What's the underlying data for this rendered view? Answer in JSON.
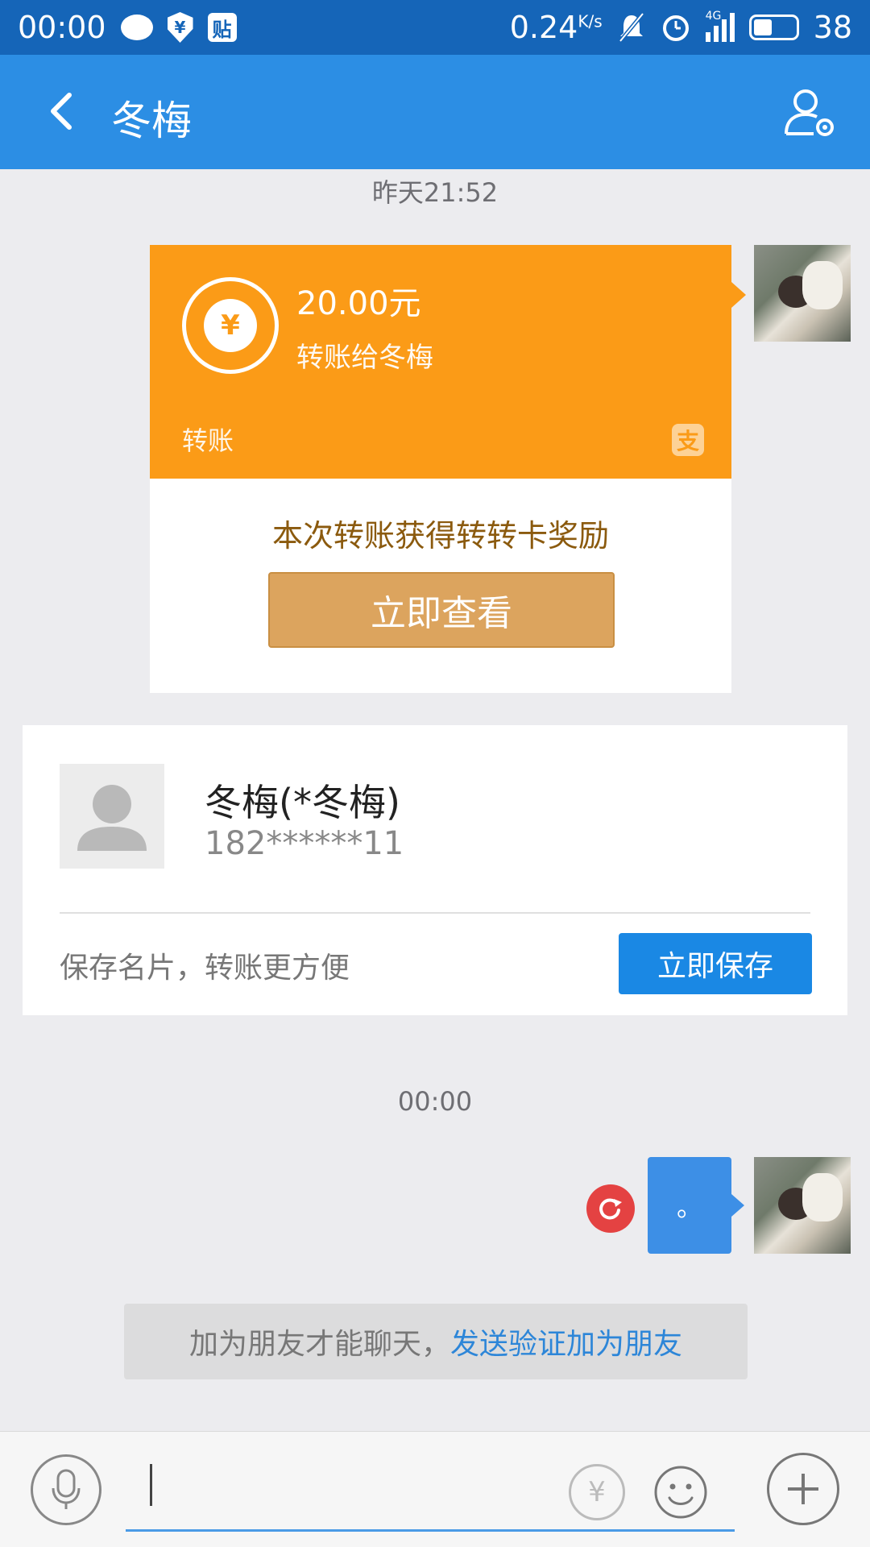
{
  "status_bar": {
    "time": "00:00",
    "badge_text": "贴",
    "shield_text": "¥",
    "speed_value": "0.24",
    "speed_unit": "K/s",
    "network": "4G",
    "battery": "38"
  },
  "header": {
    "title": "冬梅"
  },
  "messages": {
    "timestamp_1": "昨天21:52",
    "transfer": {
      "amount": "20.00元",
      "to": "转账给冬梅",
      "label": "转账",
      "yen_symbol": "¥",
      "alipay_glyph": "支",
      "reward_text": "本次转账获得转转卡奖励",
      "view_button": "立即查看",
      "color": "#fb9b17"
    },
    "contact_card": {
      "name": "冬梅(*冬梅)",
      "phone": "182******11",
      "hint": "保存名片，转账更方便",
      "save_button": "立即保存"
    },
    "timestamp_2": "00:00",
    "text_message": "。",
    "friend_notice": {
      "text": "加为朋友才能聊天，",
      "link": "发送验证加为朋友"
    }
  },
  "input_bar": {
    "placeholder": "",
    "transfer_symbol": "¥",
    "accent": "#4a9be6"
  }
}
